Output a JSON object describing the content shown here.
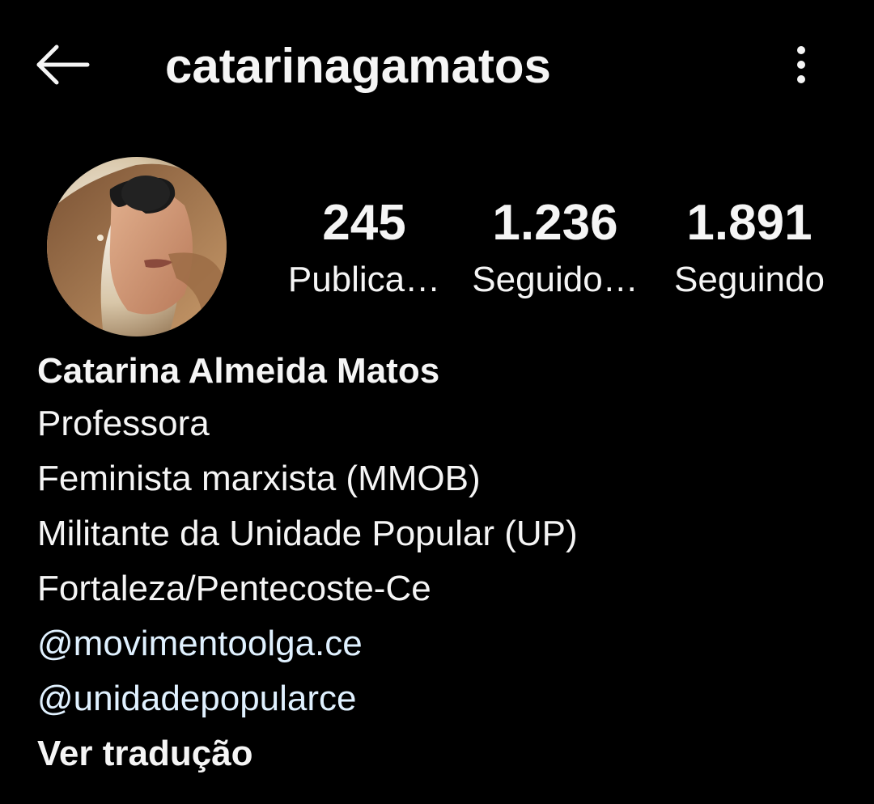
{
  "header": {
    "back_icon": "arrow-left-icon",
    "username": "catarinagamatos",
    "more_icon": "more-vertical-icon"
  },
  "profile": {
    "avatar": "profile-photo-avatar",
    "stats": [
      {
        "value": "245",
        "label": "Publica…"
      },
      {
        "value": "1.236",
        "label": "Seguido…"
      },
      {
        "value": "1.891",
        "label": "Seguindo"
      }
    ]
  },
  "bio": {
    "name": "Catarina Almeida Matos",
    "lines": [
      "Professora",
      "Feminista marxista (MMOB)",
      "Militante da Unidade Popular (UP)",
      "Fortaleza/Pentecoste-Ce"
    ],
    "mentions": [
      "@movimentoolga.ce",
      "@unidadepopularce"
    ],
    "translate_label": "Ver tradução"
  },
  "colors": {
    "background": "#000000",
    "text": "#f5f5f5",
    "mention": "#e0f1ff"
  }
}
